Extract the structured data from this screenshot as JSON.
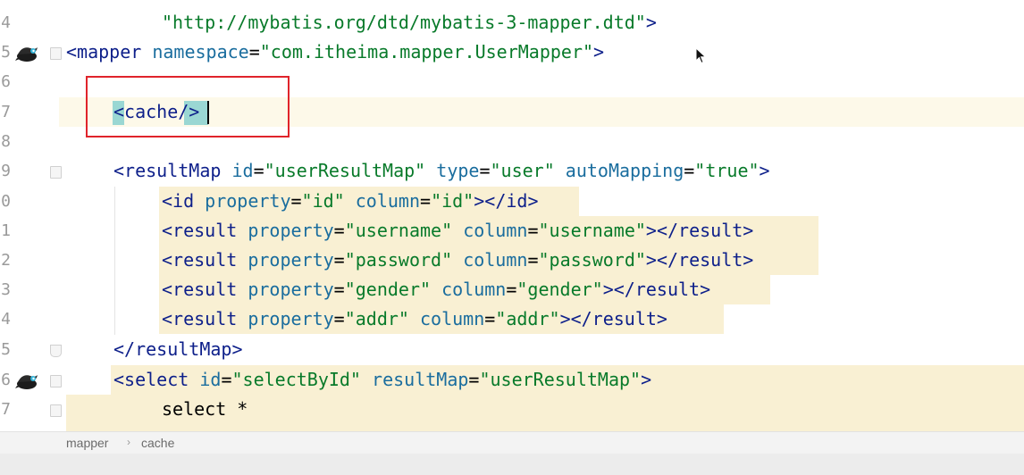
{
  "gutter": {
    "line_numbers": [
      "4",
      "5",
      "6",
      "7",
      "8",
      "9",
      "0",
      "1",
      "2",
      "3",
      "4",
      "5",
      "6",
      "7"
    ],
    "icons": [
      "mybatis-mapper-icon",
      "fold-marker-icon"
    ]
  },
  "code": {
    "line4": {
      "value": "\"http://mybatis.org/dtd/mybatis-3-mapper.dtd\"",
      "close": ">"
    },
    "line5": {
      "tag": "<mapper",
      "attr": "namespace",
      "eq": "=",
      "value": "\"com.itheima.mapper.UserMapper\"",
      "close": ">"
    },
    "line7": {
      "open": "<",
      "tag": "cache",
      "close": "/>"
    },
    "line9": {
      "tag": "<resultMap",
      "attr1": "id",
      "eq1": "=",
      "val1": "\"userResultMap\"",
      "attr2": "type",
      "eq2": "=",
      "val2": "\"user\"",
      "attr3": "autoMapping",
      "eq3": "=",
      "val3": "\"true\"",
      "close": ">"
    },
    "line10": {
      "tag": "<id",
      "attr1": "property",
      "eq1": "=",
      "val1": "\"id\"",
      "attr2": "column",
      "eq2": "=",
      "val2": "\"id\"",
      "close": "></id>"
    },
    "line11": {
      "tag": "<result",
      "attr1": "property",
      "eq1": "=",
      "val1": "\"username\"",
      "attr2": "column",
      "eq2": "=",
      "val2": "\"username\"",
      "close": "></result>"
    },
    "line12": {
      "tag": "<result",
      "attr1": "property",
      "eq1": "=",
      "val1": "\"password\"",
      "attr2": "column",
      "eq2": "=",
      "val2": "\"password\"",
      "close": "></result>"
    },
    "line13": {
      "tag": "<result",
      "attr1": "property",
      "eq1": "=",
      "val1": "\"gender\"",
      "attr2": "column",
      "eq2": "=",
      "val2": "\"gender\"",
      "close": "></result>"
    },
    "line14": {
      "tag": "<result",
      "attr1": "property",
      "eq1": "=",
      "val1": "\"addr\"",
      "attr2": "column",
      "eq2": "=",
      "val2": "\"addr\"",
      "close": "></result>"
    },
    "line15": {
      "tag": "</resultMap>"
    },
    "line16": {
      "tag": "<select",
      "attr1": "id",
      "eq1": "=",
      "val1": "\"selectById\"",
      "attr2": "resultMap",
      "eq2": "=",
      "val2": "\"userResultMap\"",
      "close": ">"
    },
    "line17": {
      "text": "select *"
    }
  },
  "breadcrumb": {
    "item1": "mapper",
    "separator": "›",
    "item2": "cache"
  },
  "colors": {
    "tag": "#0d1f8a",
    "attribute": "#1a6d9e",
    "string": "#087a2a",
    "highlight": "#f9f0d3",
    "tag_match": "#9ad7d3",
    "annotation_box": "#e0242b"
  }
}
